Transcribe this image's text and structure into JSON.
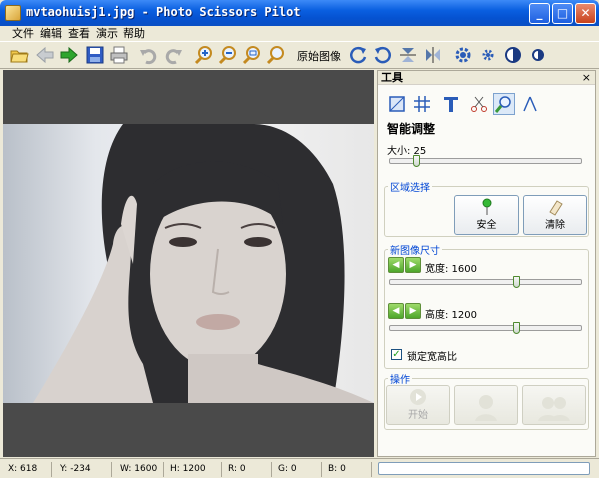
{
  "window": {
    "title": "mvtaohuisj1.jpg - Photo Scissors Pilot",
    "minimize_glyph": "_",
    "maximize_glyph": "□",
    "close_glyph": "✕"
  },
  "menu": [
    "文件",
    "编辑",
    "查看",
    "演示",
    "帮助"
  ],
  "toolbar": {
    "original_label": "原始图像",
    "icons": [
      "open-folder-icon",
      "back-arrow-icon",
      "forward-arrow-icon",
      "save-disk-icon",
      "print-icon",
      "undo-icon",
      "redo-icon",
      "zoom-in-icon",
      "zoom-out-icon",
      "zoom-fit-icon",
      "zoom-actual-icon",
      "rotate-cw-icon",
      "rotate-ccw-icon",
      "flip-vertical-icon",
      "flip-horizontal-icon",
      "settings-gear-icon",
      "settings-small-gear-icon",
      "contrast-icon",
      "brightness-icon"
    ]
  },
  "panel": {
    "header": "工具",
    "close": "×",
    "tools": [
      "crop-tool-icon",
      "grid-tool-icon",
      "text-tool-icon",
      "scissors-tool-icon",
      "smart-zoom-tool-icon",
      "pen-tool-icon"
    ],
    "active_tool": 4,
    "section_title": "智能调整",
    "size_label": "大小: 25",
    "size_value_fraction": 0.14,
    "region_group": "区域选择",
    "safe_label": "安全",
    "clear_label": "清除",
    "new_size_group": "新图像尺寸",
    "width_label": "宽度: 1600",
    "width_fraction": 0.66,
    "height_label": "高度: 1200",
    "height_fraction": 0.66,
    "lock_ratio_label": "锁定宽高比",
    "lock_checked": true,
    "ops_group": "操作",
    "start_label": "开始"
  },
  "status": {
    "x": "X: 618",
    "y": "Y: -234",
    "w": "W: 1600",
    "h": "H: 1200",
    "r": "R: 0",
    "g": "G: 0",
    "b": "B: 0"
  },
  "colors": {
    "accent": "#0a5fe0",
    "group_label": "#0046d5",
    "canvas_bg": "#4a4a4a"
  }
}
